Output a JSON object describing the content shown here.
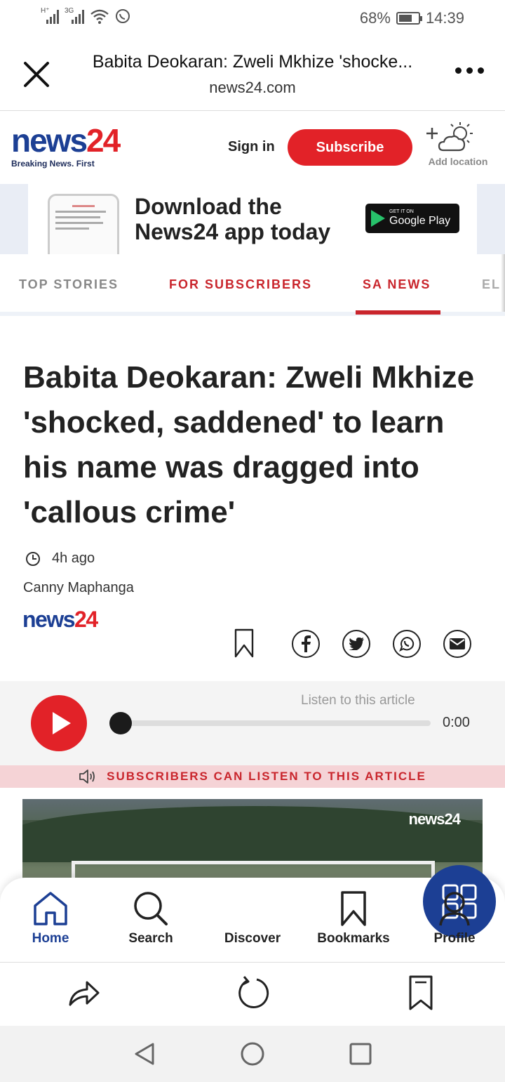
{
  "status_bar": {
    "network_1": "H⁺",
    "network_2": "3G",
    "battery": "68%",
    "battery_level": 0.68,
    "time": "14:39"
  },
  "browser": {
    "title": "Babita Deokaran: Zweli Mkhize 'shocke...",
    "url": "news24.com"
  },
  "site": {
    "logo_main_1": "news",
    "logo_main_2": "24",
    "tagline": "Breaking News. First",
    "sign_in": "Sign in",
    "subscribe": "Subscribe",
    "add_location": "Add location"
  },
  "banner": {
    "line1": "Download the",
    "line2": "News24 app today",
    "store_small": "GET IT ON",
    "store_name": "Google Play"
  },
  "tabs": [
    {
      "label": "TOP STORIES"
    },
    {
      "label": "FOR SUBSCRIBERS"
    },
    {
      "label": "SA NEWS"
    },
    {
      "label": "ELE"
    }
  ],
  "article": {
    "headline": "Babita Deokaran: Zweli Mkhize 'shocked, saddened' to learn his name was dragged into 'callous crime'",
    "time_ago": "4h ago",
    "author": "Canny Maphanga",
    "source_logo_1": "news",
    "source_logo_2": "24"
  },
  "player": {
    "listen_label": "Listen to this article",
    "time": "0:00",
    "progress": 0,
    "subscribers_note": "SUBSCRIBERS CAN LISTEN TO THIS ARTICLE"
  },
  "image": {
    "watermark": "news24"
  },
  "app_nav": [
    {
      "label": "Home",
      "icon": "home-icon"
    },
    {
      "label": "Search",
      "icon": "search-icon"
    },
    {
      "label": "Discover",
      "icon": "grid-icon"
    },
    {
      "label": "Bookmarks",
      "icon": "bookmark-icon"
    },
    {
      "label": "Profile",
      "icon": "profile-icon"
    }
  ],
  "colors": {
    "brand_blue": "#1c3f94",
    "brand_red": "#e22228",
    "tab_active": "#c9252c"
  }
}
